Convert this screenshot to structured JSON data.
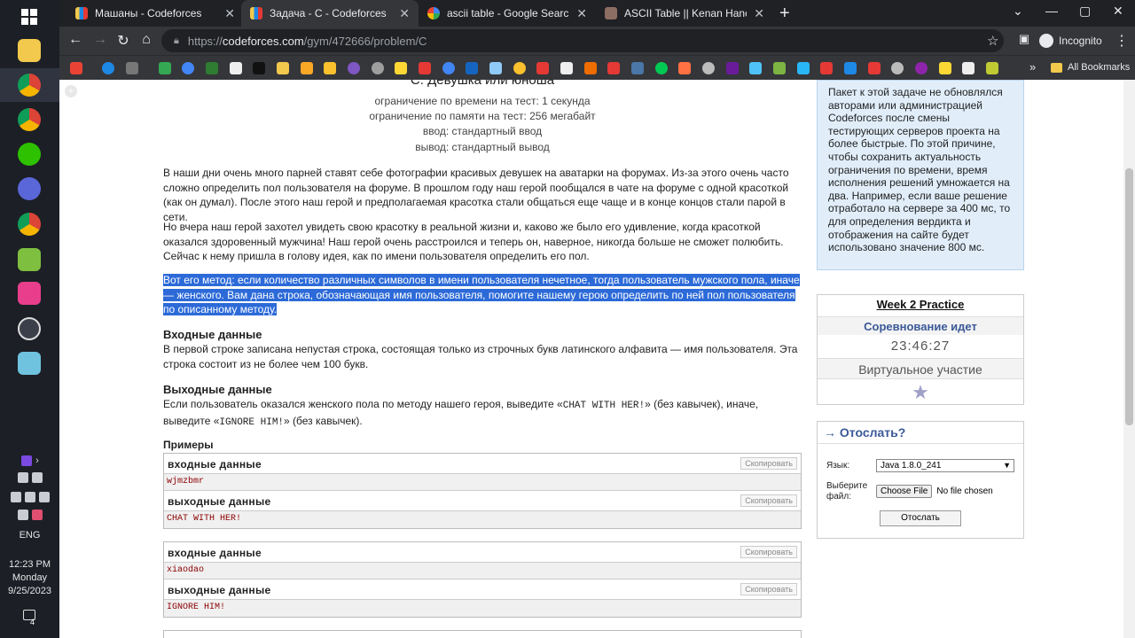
{
  "taskbar": {
    "tray_lang": "ENG",
    "clock_time": "12:23 PM",
    "clock_day": "Monday",
    "clock_date": "9/25/2023",
    "notification_count": "4"
  },
  "browser": {
    "tabs": [
      {
        "title": "Машаны - Codeforces",
        "active": false
      },
      {
        "title": "Задача - C - Codeforces",
        "active": true
      },
      {
        "title": "ascii table - Google Search",
        "active": false
      },
      {
        "title": "ASCII Table || Kenan Hançer Blog",
        "active": false
      }
    ],
    "url_scheme": "https://",
    "url_host": "codeforces.com",
    "url_path": "/gym/472666/problem/C",
    "profile_label": "Incognito",
    "all_bookmarks": "All Bookmarks"
  },
  "problem": {
    "title_partial": "С. Девушка или юноша",
    "time_limit": "ограничение по времени на тест: 1 секунда",
    "memory_limit": "ограничение по памяти на тест: 256 мегабайт",
    "input": "ввод: стандартный ввод",
    "output": "вывод: стандартный вывод",
    "para1": "В наши дни очень много парней ставят себе фотографии красивых девушек на аватарки на форумах. Из-за этого очень часто сложно определить пол пользователя на форуме. В прошлом году наш герой пообщался в чате на форуме с одной красоткой (как он думал). После этого наш герой и предполагаемая красотка стали общаться еще чаще и в конце концов стали парой в сети.",
    "para2": "Но вчера наш герой захотел увидеть свою красотку в реальной жизни и, каково же было его удивление, когда красоткой оказался здоровенный мужчина! Наш герой очень расстроился и теперь он, наверное, никогда больше не сможет полюбить. Сейчас к нему пришла в голову идея, как по имени пользователя определить его пол.",
    "para3": "Вот его метод: если количество различных символов в имени пользователя нечетное, тогда пользователь мужского пола, иначе — женского. Вам дана строка, обозначающая имя пользователя, помогите нашему герою определить по ней пол пользователя по описанному методу.",
    "input_title": "Входные данные",
    "input_text": "В первой строке записана непустая строка, состоящая только из строчных букв латинского алфавита — имя пользователя. Эта строка состоит из не более чем 100 букв.",
    "output_title": "Выходные данные",
    "output_text_a": "Если пользователь оказался женского пола по методу нашего героя, выведите «",
    "output_code_a": "CHAT WITH HER!",
    "output_text_b": "» (без кавычек), иначе, выведите «",
    "output_code_b": "IGNORE HIM!",
    "output_text_c": "» (без кавычек).",
    "examples_title": "Примеры",
    "input_label": "входные данные",
    "output_label": "выходные данные",
    "copy_label": "Скопировать",
    "samples": [
      {
        "input": "wjmzbmr",
        "output": "CHAT WITH HER!"
      },
      {
        "input": "xiaodao",
        "output": "IGNORE HIM!"
      }
    ]
  },
  "sidebar": {
    "notice": "Пакет к этой задаче не обновлялся авторами или администрацией Codeforces после смены тестирующих серверов проекта на более быстрые. По этой причине, чтобы сохранить актуальность ограничения по времени, время исполнения решений умножается на два. Например, если ваше решение отработало на сервере за 400 мс, то для определения вердикта и отображения на сайте будет использовано значение 800 мс.",
    "contest_name": "Week 2 Practice",
    "contest_status": "Соревнование идет",
    "timer": "23:46:27",
    "virtual": "Виртуальное участие",
    "submit_title": "→ Отослать?",
    "lang_label": "Язык:",
    "lang_value": "Java 1.8.0_241",
    "file_label": "Выберите файл:",
    "choose_file": "Choose File",
    "no_file": "No file chosen",
    "submit_button": "Отослать"
  },
  "colors": {
    "selection": "#2c6ad8",
    "notice_bg": "#e1eefa",
    "cf_blue": "#3b5998"
  }
}
